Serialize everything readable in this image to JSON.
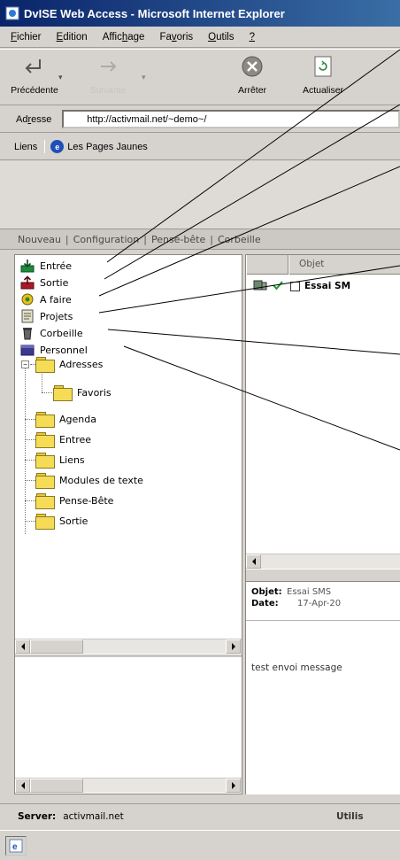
{
  "window": {
    "title": "DvISE Web Access - Microsoft Internet Explorer",
    "icon": "ie-page-icon"
  },
  "menu": {
    "items": [
      {
        "label": "Fichier",
        "icon": ""
      },
      {
        "label": "Edition"
      },
      {
        "label": "Affichage"
      },
      {
        "label": "Favoris"
      },
      {
        "label": "Outils"
      },
      {
        "label": "?"
      }
    ]
  },
  "toolbar": {
    "back": {
      "label": "Précédente",
      "icon": "back-arrow-icon"
    },
    "forward": {
      "label": "Suivante",
      "icon": "forward-arrow-icon",
      "disabled": true
    },
    "stop": {
      "label": "Arrêter",
      "icon": "stop-icon"
    },
    "refresh": {
      "label": "Actualiser",
      "icon": "refresh-icon"
    }
  },
  "address": {
    "label": "Adresse",
    "url": "http://activmail.net/~demo~/"
  },
  "links": {
    "label": "Liens",
    "item": "Les Pages Jaunes"
  },
  "appnav": {
    "items": [
      "Nouveau",
      "Configuration",
      "Pense-bête",
      "Corbeille"
    ]
  },
  "folders": {
    "main": [
      {
        "label": "Entrée",
        "icon": "inbox-icon"
      },
      {
        "label": "Sortie",
        "icon": "outbox-icon"
      },
      {
        "label": "A faire",
        "icon": "todo-icon"
      },
      {
        "label": "Projets",
        "icon": "projects-icon"
      },
      {
        "label": "Corbeille",
        "icon": "trash-icon"
      },
      {
        "label": "Personnel",
        "icon": "personal-icon"
      }
    ],
    "personal": [
      {
        "label": "Adresses"
      },
      {
        "label": "Favoris"
      },
      {
        "label": "Agenda"
      },
      {
        "label": "Entree"
      },
      {
        "label": "Liens"
      },
      {
        "label": "Modules de texte"
      },
      {
        "label": "Pense-Bête"
      },
      {
        "label": "Sortie"
      }
    ]
  },
  "message_list": {
    "column": "Objet",
    "rows": [
      {
        "subject": "Essai SM"
      }
    ]
  },
  "preview": {
    "subject_label": "Objet:",
    "subject_value": "Essai SMS",
    "date_label": "Date:",
    "date_value": "17-Apr-20",
    "body": "test envoi message"
  },
  "status": {
    "server_label": "Server:",
    "server_value": "activmail.net",
    "user_label": "Utilis"
  },
  "colors": {
    "titlebar": "#0a246a",
    "window_bg": "#d6d3ce",
    "folder_yellow": "#f6dc56"
  }
}
